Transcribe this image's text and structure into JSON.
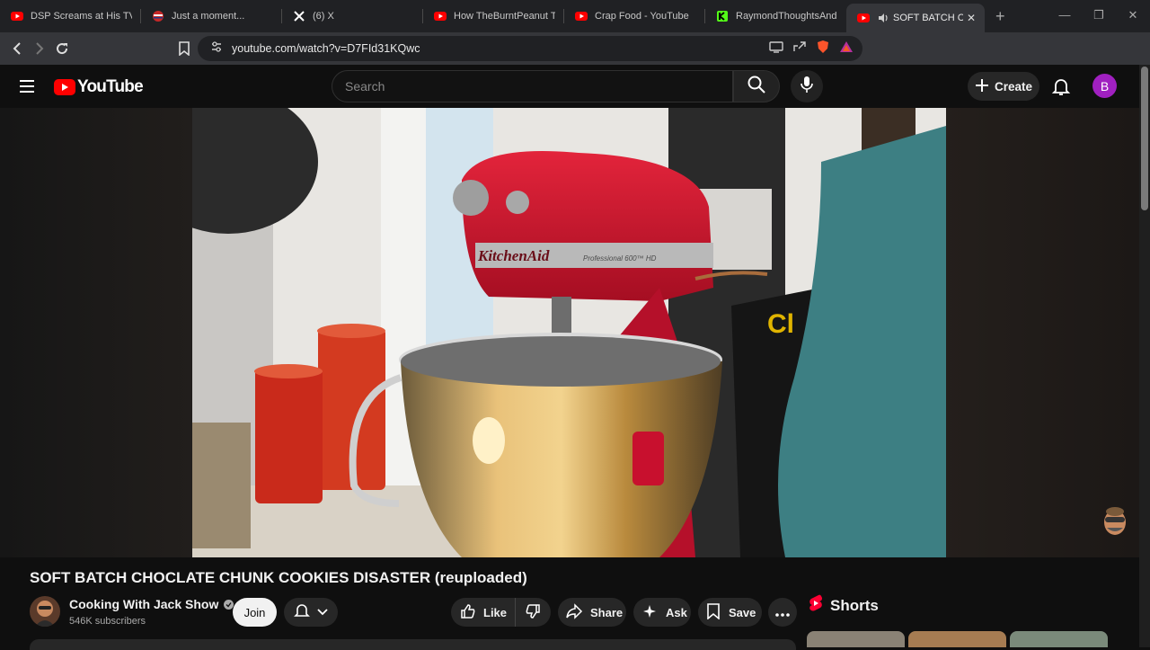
{
  "browser": {
    "tabs": [
      {
        "title": "DSP Screams at His TV as",
        "icon": "youtube-icon"
      },
      {
        "title": "Just a moment...",
        "icon": "flag-icon"
      },
      {
        "title": "(6) X",
        "icon": "x-icon"
      },
      {
        "title": "How TheBurntPeanut Took",
        "icon": "youtube-icon"
      },
      {
        "title": "Crap Food - YouTube",
        "icon": "youtube-icon"
      },
      {
        "title": "RaymondThoughtsAndMi",
        "icon": "kick-icon"
      },
      {
        "title": "SOFT BATCH CHOC",
        "icon": "youtube-icon",
        "active": true
      }
    ],
    "url": "youtube.com/watch?v=D7FId31KQwc"
  },
  "youtube": {
    "logo_text": "YouTube",
    "search_placeholder": "Search",
    "create_label": "Create",
    "avatar_letter": "B"
  },
  "video": {
    "title": "SOFT BATCH CHOCLATE CHUNK COOKIES DISASTER (reuploaded)",
    "channel_name": "Cooking With Jack Show",
    "subscribers": "546K subscribers",
    "join_label": "Join",
    "like_label": "Like",
    "share_label": "Share",
    "ask_label": "Ask",
    "save_label": "Save",
    "mixer_brand": "KitchenAid",
    "mixer_model": "Professional 600™ HD"
  },
  "sidebar": {
    "shorts_label": "Shorts"
  },
  "colors": {
    "youtube_red": "#ff0000",
    "background": "#0f0f0f",
    "mixer_red": "#c8102e",
    "avatar_purple": "#a020c0"
  }
}
